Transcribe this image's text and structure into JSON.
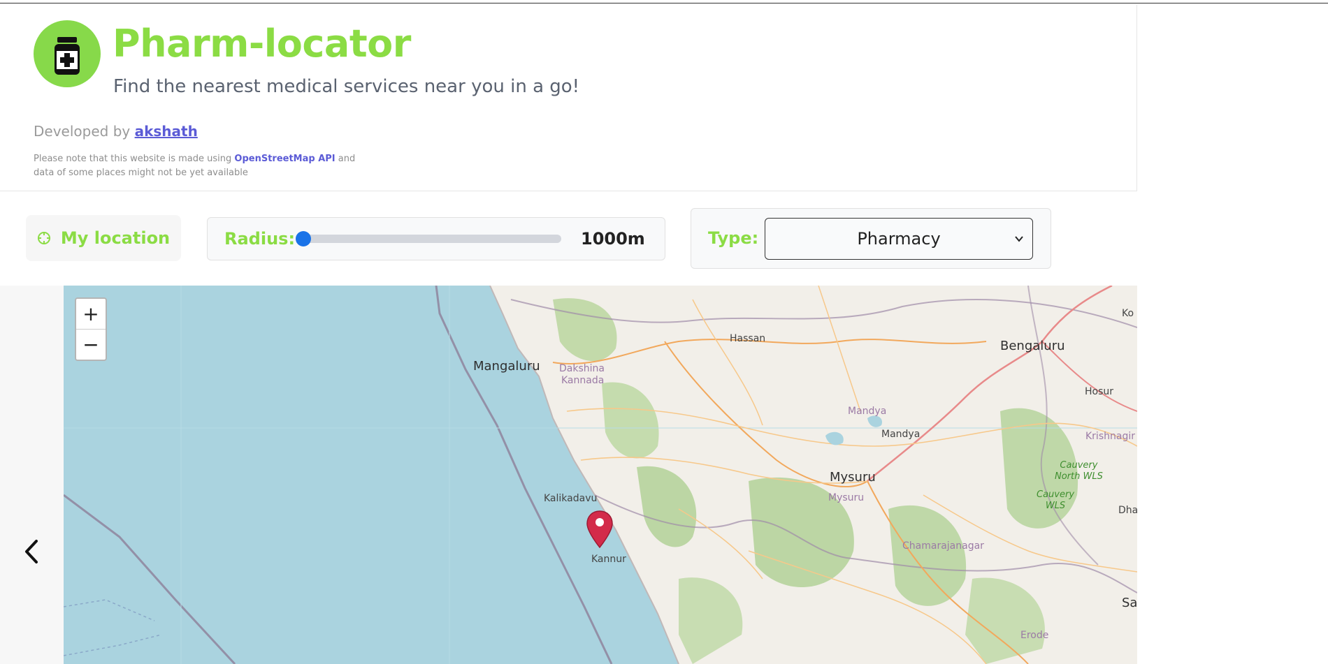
{
  "header": {
    "title": "Pharm-locator",
    "subtitle": "Find the nearest medical services near you in a go!",
    "developed_prefix": "Developed by",
    "developer_name": "akshath",
    "note_prefix": "Please note that this website is made using",
    "note_link": "OpenStreetMap API",
    "note_suffix": "and data of some places might not be yet available",
    "logo_icon": "medicine-bottle-icon",
    "accent_color": "#8bdc44"
  },
  "controls": {
    "location_button": "My location",
    "location_icon": "crosshair-icon",
    "radius_label": "Radius:",
    "radius_value": "1000m",
    "radius_slider_position": 0,
    "type_label": "Type:",
    "type_selected": "Pharmacy"
  },
  "map": {
    "zoom_in": "+",
    "zoom_out": "−",
    "labels": {
      "mangaluru": "Mangaluru",
      "dakshina": "Dakshina",
      "kannada": "Kannada",
      "hassan": "Hassan",
      "bengaluru": "Bengaluru",
      "hosur": "Hosur",
      "mandya_region": "Mandya",
      "mandya": "Mandya",
      "krishnagiri": "Krishnagir",
      "mysuru": "Mysuru",
      "mysuru_region": "Mysuru",
      "cauvery_north_1": "Cauvery",
      "cauvery_north_2": "North WLS",
      "cauvery_1": "Cauvery",
      "cauvery_2": "WLS",
      "kalikadavu": "Kalikadavu",
      "kannur": "Kannur",
      "chamarajanagar": "Chamarajanagar",
      "dhar": "Dhar",
      "erode": "Erode",
      "sa": "Sa",
      "ko": "Ko"
    },
    "marker_icon": "map-pin-icon"
  },
  "nav": {
    "back_icon": "chevron-left-icon"
  }
}
